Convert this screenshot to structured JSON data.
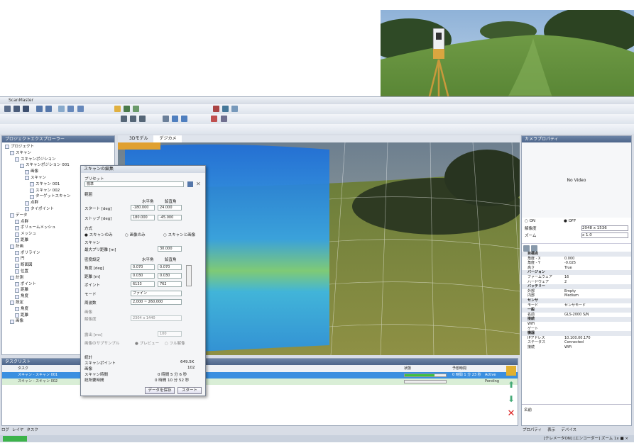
{
  "app": {
    "title": "ScanMaster",
    "view_tabs": [
      "3Dモデル",
      "デジカメ"
    ],
    "left_panel_title": "プロジェクトエクスプローラー",
    "right_panel_title": "カメラプロパティ",
    "no_video": "No Video",
    "camera_on": "ON",
    "camera_off": "OFF",
    "camera_state_label": "解像度",
    "camera_zoom_label": "ズーム",
    "camera_resolution": "2048 x 1536",
    "camera_zoom": "x 1.0",
    "bottom_panel_title": "タスクリスト",
    "status_tabs": [
      "ログ",
      "レイヤ",
      "タスク"
    ],
    "right_status_tabs": [
      "プロパティ",
      "表示",
      "デバイス"
    ],
    "status_bar_text": "[テレメータON] [エンコーダー] ズーム 1x ■ ×"
  },
  "tree": {
    "items": [
      {
        "label": "プロジェクト",
        "indent": 0
      },
      {
        "label": "スキャン",
        "indent": 1
      },
      {
        "label": "スキャンポジション",
        "indent": 2
      },
      {
        "label": "スキャンポジション 001",
        "indent": 3
      },
      {
        "label": "画像",
        "indent": 4
      },
      {
        "label": "スキャン",
        "indent": 4
      },
      {
        "label": "スキャン 001",
        "indent": 5
      },
      {
        "label": "スキャン 002",
        "indent": 5
      },
      {
        "label": "ターゲットスキャン",
        "indent": 5
      },
      {
        "label": "点群",
        "indent": 4
      },
      {
        "label": "タイポイント",
        "indent": 4
      },
      {
        "label": "データ",
        "indent": 1
      },
      {
        "label": "点群",
        "indent": 2
      },
      {
        "label": "ボリュームメッシュ",
        "indent": 2
      },
      {
        "label": "メッシュ",
        "indent": 2
      },
      {
        "label": "距離",
        "indent": 2
      },
      {
        "label": "計画",
        "indent": 1
      },
      {
        "label": "ポリライン",
        "indent": 2
      },
      {
        "label": "円",
        "indent": 2
      },
      {
        "label": "断面図",
        "indent": 2
      },
      {
        "label": "位置",
        "indent": 2
      },
      {
        "label": "計測",
        "indent": 1
      },
      {
        "label": "ポイント",
        "indent": 2
      },
      {
        "label": "距離",
        "indent": 2
      },
      {
        "label": "角度",
        "indent": 2
      },
      {
        "label": "設定",
        "indent": 1
      },
      {
        "label": "角度",
        "indent": 2
      },
      {
        "label": "距離",
        "indent": 2
      },
      {
        "label": "画像",
        "indent": 1
      }
    ]
  },
  "dialog": {
    "title": "スキャンの編集",
    "template_label": "プリセット",
    "template_value": "標準",
    "range_heading": "範囲",
    "col_horizontal": "水平角",
    "col_vertical": "鉛直角",
    "start_label": "スタート [deg]",
    "stop_label": "ストップ [deg]",
    "start_h": "-180.000",
    "start_v": "24.000",
    "stop_h": "180.000",
    "stop_v": "-45.000",
    "mode_heading": "方式",
    "radio_scan": "スキャンのみ",
    "radio_image": "画像のみ",
    "radio_both": "スキャンと画像",
    "scan_heading": "スキャン",
    "interval_label": "最大プリ距離 [m]",
    "interval_value": "30.000",
    "density_heading": "密度設定",
    "density_h": "水平角",
    "density_v": "鉛直角",
    "angle_label": "角度 [deg]",
    "angle_h": "0.070",
    "angle_v": "0.070",
    "dist_label": "距離 [m]",
    "dist_h": "0.030",
    "dist_v": "0.030",
    "points_label": "ポイント",
    "points_h": "6133",
    "points_v": "762",
    "mode_label": "モード",
    "mode_value": "ファイン",
    "freq_label": "周波数",
    "freq_value": "2,000 ~ 260,000",
    "image_heading": "画像",
    "resolution_label": "解像度",
    "resolution_value": "2304 x 1440",
    "exposure_label": "露出 [ms]",
    "exposure_value": "100",
    "resample_label": "画像のサブサンプル",
    "radio_preview": "プレビュー",
    "radio_full": "フル解像",
    "summary_heading": "統計",
    "sum_points_label": "スキャンポイント",
    "sum_points_value": "649.5K",
    "sum_images_label": "画像",
    "sum_images_value": "102",
    "sum_time_label": "スキャン時間",
    "sum_time_value": "0 時間 5 分 6 秒",
    "sum_total_label": "総所要時間",
    "sum_total_value": "0 時間 10 分 52 秒",
    "btn_estimate": "データを保存",
    "btn_start": "スタート"
  },
  "properties": {
    "rows": [
      {
        "k": "目標点",
        "v": "",
        "section": true
      },
      {
        "k": "角度 - X",
        "v": "0.000",
        "section": false
      },
      {
        "k": "角度 - Y",
        "v": "-0.025",
        "section": false
      },
      {
        "k": "高さ",
        "v": "True",
        "section": false
      },
      {
        "k": "バージョン",
        "v": "",
        "section": true
      },
      {
        "k": "ファームウェア",
        "v": "16",
        "section": false
      },
      {
        "k": "ハードウェア",
        "v": "2",
        "section": false
      },
      {
        "k": "バッテリー",
        "v": "",
        "section": true
      },
      {
        "k": "外部",
        "v": "Empty",
        "section": false
      },
      {
        "k": "内部",
        "v": "Medium",
        "section": false
      },
      {
        "k": "センサ",
        "v": "",
        "section": true
      },
      {
        "k": "モード",
        "v": "センサモード",
        "section": false
      },
      {
        "k": "一般",
        "v": "",
        "section": true
      },
      {
        "k": "名前",
        "v": "GLS-2000 S/N",
        "section": false
      },
      {
        "k": "接続",
        "v": "",
        "section": true
      },
      {
        "k": "WiFi",
        "v": "",
        "section": false
      },
      {
        "k": "ゲート",
        "v": "",
        "section": false
      },
      {
        "k": "機器",
        "v": "",
        "section": true
      },
      {
        "k": "IPアドレス",
        "v": "10.100.00.170",
        "section": false
      },
      {
        "k": "ステータス",
        "v": "Connected",
        "section": false
      },
      {
        "k": "接続",
        "v": "WiFi",
        "section": false
      }
    ],
    "footer_label": "名前"
  },
  "tasks": {
    "headers": [
      "タスク",
      "状態",
      "予想時間"
    ],
    "rows": [
      {
        "name": "スキャン - スキャン 001",
        "progress": 0.72,
        "time": "0 時間 1 分 23 秒",
        "status": "Active"
      },
      {
        "name": "スキャン - スキャン 002",
        "progress": 0,
        "time": "",
        "status": "Pending"
      }
    ]
  },
  "colors": {
    "accent": "#3b78c4",
    "selection": "#3a8fe0",
    "progress": "#3cc23c",
    "panel_head": "#4d658a"
  }
}
